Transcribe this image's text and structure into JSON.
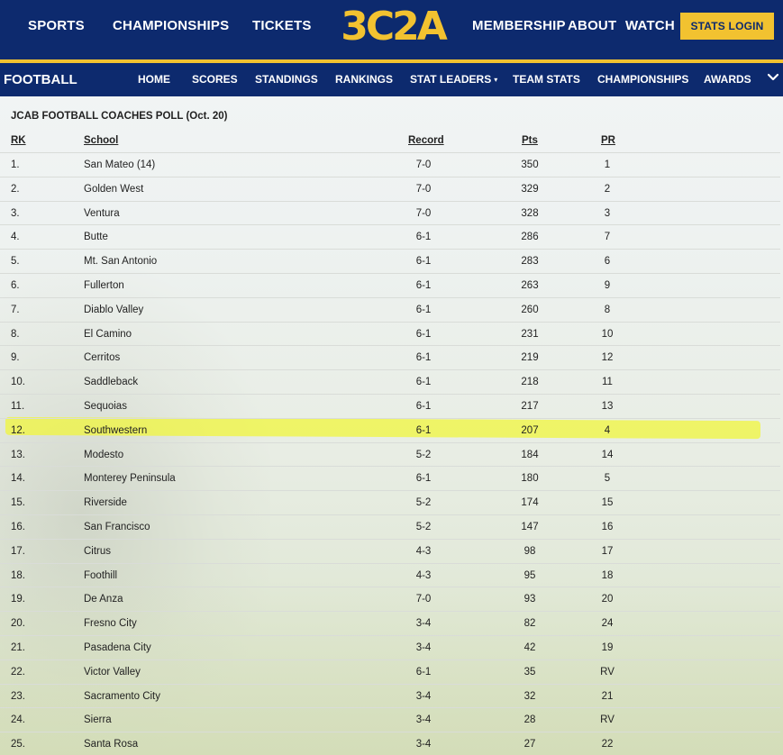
{
  "topnav": {
    "items": [
      "SPORTS",
      "CHAMPIONSHIPS",
      "TICKETS",
      "MEMBERSHIP",
      "ABOUT",
      "WATCH"
    ],
    "logo": "3C2A",
    "stats_login": "STATS LOGIN"
  },
  "subnav": {
    "title": "FOOTBALL",
    "items": [
      "HOME",
      "SCORES",
      "STANDINGS",
      "RANKINGS",
      "STAT LEADERS",
      "TEAM STATS",
      "CHAMPIONSHIPS",
      "AWARDS"
    ],
    "dropdown_caret": "▾"
  },
  "poll": {
    "title": "JCAB FOOTBALL COACHES POLL (Oct. 20)",
    "headers": {
      "rk": "RK",
      "school": "School",
      "record": "Record",
      "pts": "Pts",
      "pr": "PR"
    },
    "rows": [
      {
        "rk": "1.",
        "school": "San Mateo (14)",
        "record": "7-0",
        "pts": "350",
        "pr": "1"
      },
      {
        "rk": "2.",
        "school": "Golden West",
        "record": "7-0",
        "pts": "329",
        "pr": "2"
      },
      {
        "rk": "3.",
        "school": "Ventura",
        "record": "7-0",
        "pts": "328",
        "pr": "3"
      },
      {
        "rk": "4.",
        "school": "Butte",
        "record": "6-1",
        "pts": "286",
        "pr": "7"
      },
      {
        "rk": "5.",
        "school": "Mt. San Antonio",
        "record": "6-1",
        "pts": "283",
        "pr": "6"
      },
      {
        "rk": "6.",
        "school": "Fullerton",
        "record": "6-1",
        "pts": "263",
        "pr": "9"
      },
      {
        "rk": "7.",
        "school": "Diablo Valley",
        "record": "6-1",
        "pts": "260",
        "pr": "8"
      },
      {
        "rk": "8.",
        "school": "El Camino",
        "record": "6-1",
        "pts": "231",
        "pr": "10"
      },
      {
        "rk": "9.",
        "school": "Cerritos",
        "record": "6-1",
        "pts": "219",
        "pr": "12"
      },
      {
        "rk": "10.",
        "school": "Saddleback",
        "record": "6-1",
        "pts": "218",
        "pr": "11"
      },
      {
        "rk": "11.",
        "school": "Sequoias",
        "record": "6-1",
        "pts": "217",
        "pr": "13"
      },
      {
        "rk": "12.",
        "school": "Southwestern",
        "record": "6-1",
        "pts": "207",
        "pr": "4"
      },
      {
        "rk": "13.",
        "school": "Modesto",
        "record": "5-2",
        "pts": "184",
        "pr": "14"
      },
      {
        "rk": "14.",
        "school": "Monterey Peninsula",
        "record": "6-1",
        "pts": "180",
        "pr": "5"
      },
      {
        "rk": "15.",
        "school": "Riverside",
        "record": "5-2",
        "pts": "174",
        "pr": "15"
      },
      {
        "rk": "16.",
        "school": "San Francisco",
        "record": "5-2",
        "pts": "147",
        "pr": "16"
      },
      {
        "rk": "17.",
        "school": "Citrus",
        "record": "4-3",
        "pts": "98",
        "pr": "17"
      },
      {
        "rk": "18.",
        "school": "Foothill",
        "record": "4-3",
        "pts": "95",
        "pr": "18"
      },
      {
        "rk": "19.",
        "school": "De Anza",
        "record": "7-0",
        "pts": "93",
        "pr": "20"
      },
      {
        "rk": "20.",
        "school": "Fresno City",
        "record": "3-4",
        "pts": "82",
        "pr": "24"
      },
      {
        "rk": "21.",
        "school": "Pasadena City",
        "record": "3-4",
        "pts": "42",
        "pr": "19"
      },
      {
        "rk": "22.",
        "school": "Victor Valley",
        "record": "6-1",
        "pts": "35",
        "pr": "RV"
      },
      {
        "rk": "23.",
        "school": "Sacramento City",
        "record": "3-4",
        "pts": "32",
        "pr": "21"
      },
      {
        "rk": "24.",
        "school": "Sierra",
        "record": "3-4",
        "pts": "28",
        "pr": "RV"
      },
      {
        "rk": "25.",
        "school": "Santa Rosa",
        "record": "3-4",
        "pts": "27",
        "pr": "22"
      }
    ]
  },
  "colors": {
    "navy": "#0d2a6e",
    "gold": "#f2c230",
    "highlight": "#f0f53c"
  }
}
